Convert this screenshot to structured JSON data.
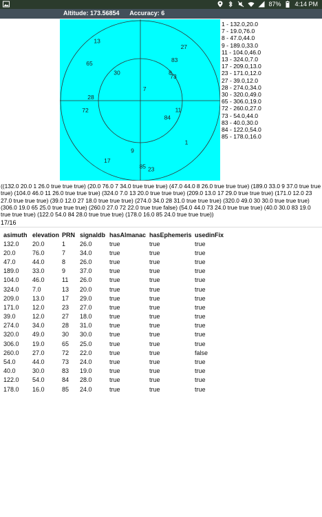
{
  "status_bar": {
    "battery": "87%",
    "time": "4:14 PM"
  },
  "header": {
    "altitude_label": "Altitude: 173.56854",
    "accuracy_label": "Accuracy: 6"
  },
  "radar": {
    "background": "#00ffff",
    "satellites": [
      {
        "prn": "13",
        "azimuth": 324.0,
        "elevation": 7.0
      },
      {
        "prn": "27",
        "azimuth": 39.0,
        "elevation": 12.0
      },
      {
        "prn": "65",
        "azimuth": 306.0,
        "elevation": 19.0
      },
      {
        "prn": "83",
        "azimuth": 40.0,
        "elevation": 30.0
      },
      {
        "prn": "30",
        "azimuth": 320.0,
        "elevation": 49.0
      },
      {
        "prn": "8",
        "azimuth": 47.0,
        "elevation": 44.0
      },
      {
        "prn": "73",
        "azimuth": 54.0,
        "elevation": 44.0
      },
      {
        "prn": "7",
        "azimuth": 20.0,
        "elevation": 76.0
      },
      {
        "prn": "28",
        "azimuth": 274.0,
        "elevation": 34.0
      },
      {
        "prn": "72",
        "azimuth": 260.0,
        "elevation": 27.0
      },
      {
        "prn": "11",
        "azimuth": 104.0,
        "elevation": 46.0
      },
      {
        "prn": "84",
        "azimuth": 122.0,
        "elevation": 54.0
      },
      {
        "prn": "1",
        "azimuth": 132.0,
        "elevation": 20.0
      },
      {
        "prn": "9",
        "azimuth": 189.0,
        "elevation": 33.0
      },
      {
        "prn": "17",
        "azimuth": 209.0,
        "elevation": 13.0
      },
      {
        "prn": "85",
        "azimuth": 178.0,
        "elevation": 16.0
      },
      {
        "prn": "23",
        "azimuth": 171.0,
        "elevation": 12.0
      }
    ]
  },
  "sat_legend": [
    "1  -  132.0,20.0",
    "7  -  19.0,76.0",
    "8  -  47.0,44.0",
    "9  -  189.0,33.0",
    "11  -  104.0,46.0",
    "13  -  324.0,7.0",
    "17  -  209.0,13.0",
    "23  -  171.0,12.0",
    "27  -  39.0,12.0",
    "28  -  274.0,34.0",
    "30  -  320.0,49.0",
    "65  -  306.0,19.0",
    "72  -  260.0,27.0",
    "73  -  54.0,44.0",
    "83  -  40.0,30.0",
    "84  -  122.0,54.0",
    "85  -  178.0,16.0"
  ],
  "raw_text": "((132.0 20.0 1 26.0 true true true) (20.0 76.0 7 34.0 true true true) (47.0 44.0 8 26.0 true true true) (189.0 33.0 9 37.0 true true true) (104.0 46.0 11 26.0 true true true) (324.0 7.0 13 20.0 true true true) (209.0 13.0 17 29.0 true true true) (171.0 12.0 23 27.0 true true true) (39.0 12.0 27 18.0 true true true) (274.0 34.0 28 31.0 true true true) (320.0 49.0 30 30.0 true true true) (306.0 19.0 65 25.0 true true true) (260.0 27.0 72 22.0 true true false) (54.0 44.0 73 24.0 true true true) (40.0 30.0 83 19.0 true true true) (122.0 54.0 84 28.0 true true true) (178.0 16.0 85 24.0 true true true))",
  "count": "17/16",
  "table": {
    "headers": [
      "asimuth",
      "elevation",
      "PRN",
      "signaldb",
      "hasAlmanac",
      "hasEphemeris",
      "usedinFix"
    ],
    "rows": [
      [
        "132.0",
        "20.0",
        "1",
        "26.0",
        "true",
        "true",
        "true"
      ],
      [
        "20.0",
        "76.0",
        "7",
        "34.0",
        "true",
        "true",
        "true"
      ],
      [
        "47.0",
        "44.0",
        "8",
        "26.0",
        "true",
        "true",
        "true"
      ],
      [
        "189.0",
        "33.0",
        "9",
        "37.0",
        "true",
        "true",
        "true"
      ],
      [
        "104.0",
        "46.0",
        "11",
        "26.0",
        "true",
        "true",
        "true"
      ],
      [
        "324.0",
        "7.0",
        "13",
        "20.0",
        "true",
        "true",
        "true"
      ],
      [
        "209.0",
        "13.0",
        "17",
        "29.0",
        "true",
        "true",
        "true"
      ],
      [
        "171.0",
        "12.0",
        "23",
        "27.0",
        "true",
        "true",
        "true"
      ],
      [
        "39.0",
        "12.0",
        "27",
        "18.0",
        "true",
        "true",
        "true"
      ],
      [
        "274.0",
        "34.0",
        "28",
        "31.0",
        "true",
        "true",
        "true"
      ],
      [
        "320.0",
        "49.0",
        "30",
        "30.0",
        "true",
        "true",
        "true"
      ],
      [
        "306.0",
        "19.0",
        "65",
        "25.0",
        "true",
        "true",
        "true"
      ],
      [
        "260.0",
        "27.0",
        "72",
        "22.0",
        "true",
        "true",
        "false"
      ],
      [
        "54.0",
        "44.0",
        "73",
        "24.0",
        "true",
        "true",
        "true"
      ],
      [
        "40.0",
        "30.0",
        "83",
        "19.0",
        "true",
        "true",
        "true"
      ],
      [
        "122.0",
        "54.0",
        "84",
        "28.0",
        "true",
        "true",
        "true"
      ],
      [
        "178.0",
        "16.0",
        "85",
        "24.0",
        "true",
        "true",
        "true"
      ]
    ]
  }
}
